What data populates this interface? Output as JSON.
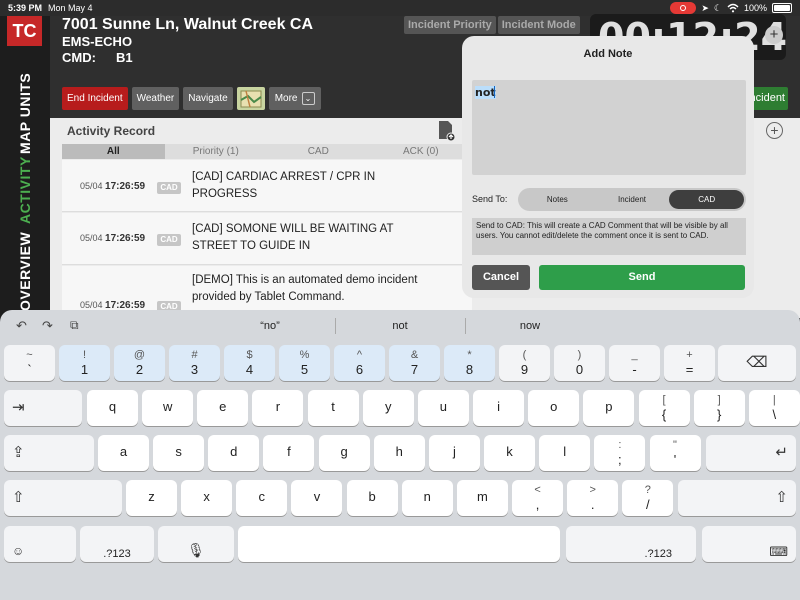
{
  "status_bar": {
    "time": "5:39 PM",
    "date": "Mon May 4",
    "battery": "100%"
  },
  "sidebar": {
    "logo": "TC",
    "tabs": [
      {
        "label": "MAP UNITS",
        "active": false
      },
      {
        "label": "ACTIVITY",
        "active": true
      },
      {
        "label": "OVERVIEW",
        "active": false
      }
    ]
  },
  "header": {
    "address": "7001 Sunne Ln, Walnut Creek CA",
    "unit": "EMS-ECHO",
    "cmd_label": "CMD:",
    "cmd_value": "B1",
    "incident_priority": "Incident Priority",
    "incident_mode": "Incident Mode",
    "timer": "00:12:24",
    "buttons": {
      "end_incident": "End Incident",
      "weather": "Weather",
      "navigate": "Navigate",
      "more": "More"
    },
    "incident_btn": "ncident"
  },
  "activity": {
    "title": "Activity Record",
    "tabs": [
      {
        "label": "All",
        "selected": true
      },
      {
        "label": "Priority (1)",
        "selected": false
      },
      {
        "label": "CAD",
        "selected": false
      },
      {
        "label": "ACK (0)",
        "selected": false
      }
    ],
    "rows": [
      {
        "date": "05/04",
        "time": "17:26:59",
        "badge": "CAD",
        "text": "[CAD] CARDIAC ARREST / CPR IN PROGRESS"
      },
      {
        "date": "05/04",
        "time": "17:26:59",
        "badge": "CAD",
        "text": "[CAD] SOMONE WILL BE WAITING AT STREET TO GUIDE IN"
      },
      {
        "date": "05/04",
        "time": "17:26:59",
        "badge": "CAD",
        "text": "[DEMO] This is an automated demo incident provided by Tablet Command."
      }
    ]
  },
  "modal": {
    "title": "Add Note",
    "note_text": "not",
    "send_to_label": "Send To:",
    "send_options": [
      {
        "label": "Notes",
        "selected": false
      },
      {
        "label": "Incident",
        "selected": false
      },
      {
        "label": "CAD",
        "selected": true
      }
    ],
    "info": "Send to CAD: This will create a CAD Comment that will be visible by all users. You cannot edit/delete the comment once it is sent to CAD.",
    "cancel_label": "Cancel",
    "send_label": "Send"
  },
  "keyboard": {
    "predictions": [
      "“no”",
      "not",
      "now"
    ],
    "row1": [
      {
        "sym": "~",
        "main": "`"
      },
      {
        "sym": "!",
        "main": "1",
        "hl": true
      },
      {
        "sym": "@",
        "main": "2",
        "hl": true
      },
      {
        "sym": "#",
        "main": "3",
        "hl": true
      },
      {
        "sym": "$",
        "main": "4",
        "hl": true
      },
      {
        "sym": "%",
        "main": "5",
        "hl": true
      },
      {
        "sym": "^",
        "main": "6",
        "hl": true
      },
      {
        "sym": "&",
        "main": "7",
        "hl": true
      },
      {
        "sym": "*",
        "main": "8",
        "hl": true
      },
      {
        "sym": "(",
        "main": "9"
      },
      {
        "sym": ")",
        "main": "0"
      },
      {
        "sym": "_",
        "main": "-"
      },
      {
        "sym": "+",
        "main": "="
      }
    ],
    "row2": [
      {
        "main": "q"
      },
      {
        "main": "w"
      },
      {
        "main": "e"
      },
      {
        "main": "r"
      },
      {
        "main": "t"
      },
      {
        "main": "y"
      },
      {
        "main": "u"
      },
      {
        "main": "i"
      },
      {
        "main": "o"
      },
      {
        "main": "p"
      },
      {
        "sym": "[",
        "main": "{"
      },
      {
        "sym": "]",
        "main": "}"
      },
      {
        "sym": "|",
        "main": "\\"
      }
    ],
    "row3": [
      {
        "main": "a"
      },
      {
        "main": "s"
      },
      {
        "main": "d"
      },
      {
        "main": "f"
      },
      {
        "main": "g"
      },
      {
        "main": "h"
      },
      {
        "main": "j"
      },
      {
        "main": "k"
      },
      {
        "main": "l"
      },
      {
        "sym": ":",
        "main": ";"
      },
      {
        "sym": "\"",
        "main": "'"
      }
    ],
    "row4": [
      {
        "main": "z"
      },
      {
        "main": "x"
      },
      {
        "main": "c"
      },
      {
        "main": "v"
      },
      {
        "main": "b"
      },
      {
        "main": "n"
      },
      {
        "main": "m"
      },
      {
        "sym": "<",
        "main": ","
      },
      {
        "sym": ">",
        "main": "."
      },
      {
        "sym": "?",
        "main": "/"
      }
    ],
    "numbers_key": ".?123",
    "numbers_key_right": ".?123"
  }
}
